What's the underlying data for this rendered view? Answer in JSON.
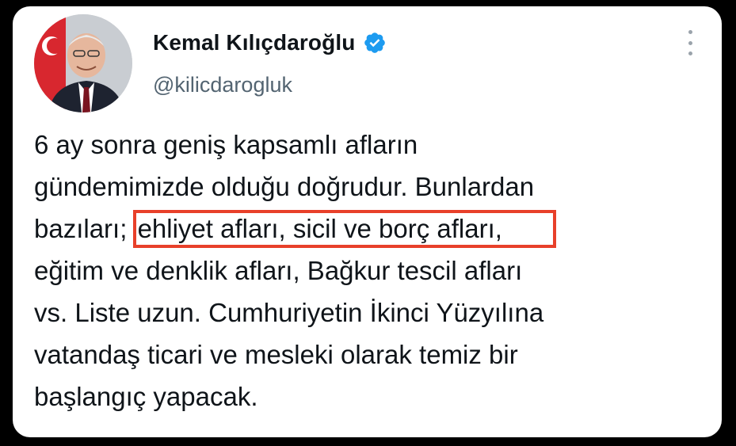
{
  "tweet": {
    "author": {
      "display_name": "Kemal Kılıçdaroğlu",
      "handle": "@kilicdarogluk",
      "verified": true,
      "verified_icon": "verified-badge-icon",
      "avatar_icon": "profile-photo"
    },
    "more_icon": "more-options-vertical-icon",
    "text_lines": [
      "6 ay sonra geniş kapsamlı afların",
      "gündemimizde olduğu doğrudur. Bunlardan",
      "bazıları; ",
      "eğitim ve denklik afları, Bağkur tescil afları",
      "vs. Liste uzun. Cumhuriyetin İkinci Yüzyılına",
      "vatandaş ticari ve mesleki olarak temiz bir",
      "başlangıç yapacak."
    ],
    "highlighted_phrase": "ehliyet afları, sicil ve borç afları,",
    "highlight_color": "#e8402a"
  },
  "colors": {
    "verified_blue": "#1d9bf0",
    "text_primary": "#0f1419",
    "text_secondary": "#536471"
  }
}
